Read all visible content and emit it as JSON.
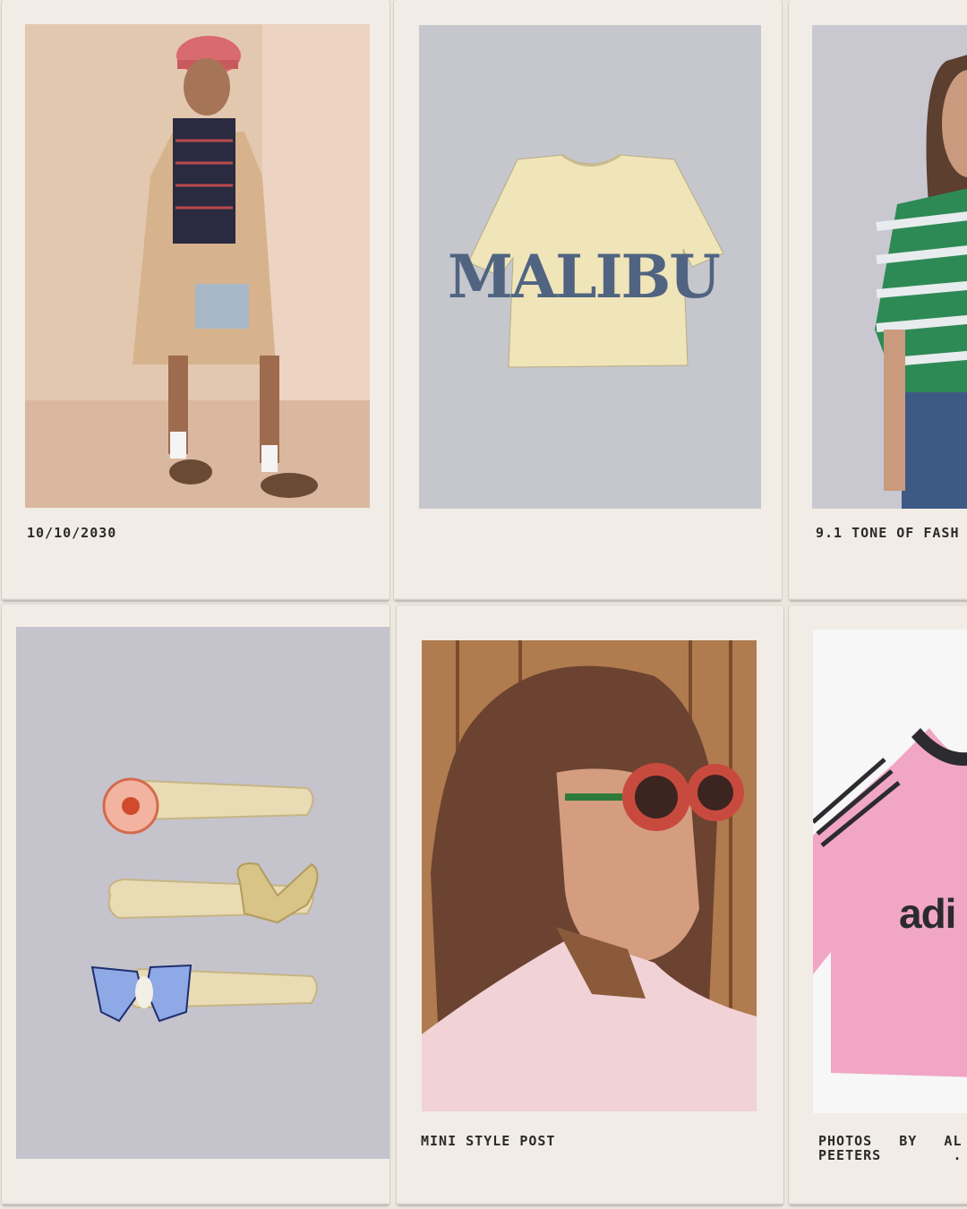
{
  "cards": [
    {
      "caption": "10/10/2030",
      "image": "girl in beige trench coat and pink cap"
    },
    {
      "caption": "",
      "image": "cream cropped t-shirt with MALIBU print",
      "print": "MALIBU"
    },
    {
      "caption": "9.1 TONE OF FASH",
      "image": "girl in green striped t-shirt"
    },
    {
      "caption": "",
      "image": "three decorative hair clips"
    },
    {
      "caption": "MINI STYLE POST",
      "image": "girl wearing red flower sunglasses"
    },
    {
      "caption": "PHOTOS   BY   AL\nPEETERS        .",
      "image": "pink striped sports jersey",
      "print": "adi"
    }
  ],
  "colors": {
    "frame": "#f1ece5",
    "background": "#ece7df",
    "caption_text": "#2a2a2a"
  }
}
